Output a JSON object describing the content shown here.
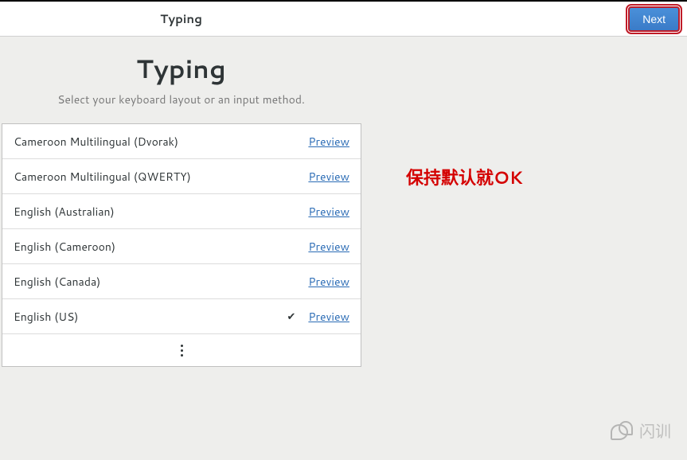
{
  "header": {
    "title": "Typing",
    "next_label": "Next"
  },
  "page": {
    "title": "Typing",
    "subtitle": "Select your keyboard layout or an input method."
  },
  "layouts": [
    {
      "label": "Cameroon Multilingual (Dvorak)",
      "selected": false,
      "preview": "Preview"
    },
    {
      "label": "Cameroon Multilingual (QWERTY)",
      "selected": false,
      "preview": "Preview"
    },
    {
      "label": "English (Australian)",
      "selected": false,
      "preview": "Preview"
    },
    {
      "label": "English (Cameroon)",
      "selected": false,
      "preview": "Preview"
    },
    {
      "label": "English (Canada)",
      "selected": false,
      "preview": "Preview"
    },
    {
      "label": "English (US)",
      "selected": true,
      "preview": "Preview"
    }
  ],
  "annotation": "保持默认就OK",
  "watermark": "闪训"
}
